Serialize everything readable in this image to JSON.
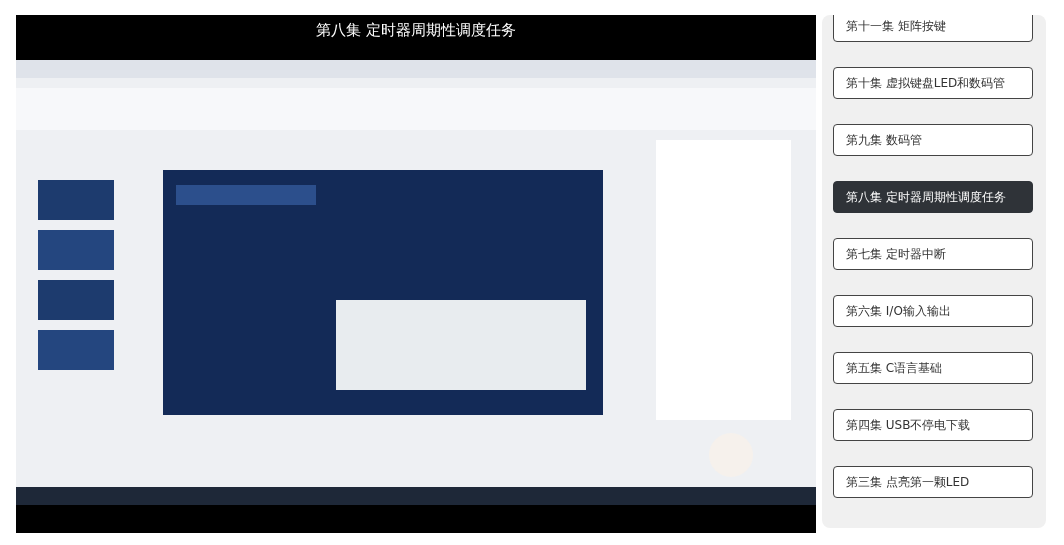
{
  "player": {
    "title": "第八集 定时器周期性调度任务"
  },
  "episodes": [
    {
      "label": "第十一集 矩阵按键",
      "selected": false
    },
    {
      "label": "第十集 虚拟键盘LED和数码管",
      "selected": false
    },
    {
      "label": "第九集 数码管",
      "selected": false
    },
    {
      "label": "第八集 定时器周期性调度任务",
      "selected": true
    },
    {
      "label": "第七集 定时器中断",
      "selected": false
    },
    {
      "label": "第六集 I/O输入输出",
      "selected": false
    },
    {
      "label": "第五集 C语言基础",
      "selected": false
    },
    {
      "label": "第四集 USB不停电下载",
      "selected": false
    },
    {
      "label": "第三集 点亮第一颗LED",
      "selected": false
    }
  ]
}
